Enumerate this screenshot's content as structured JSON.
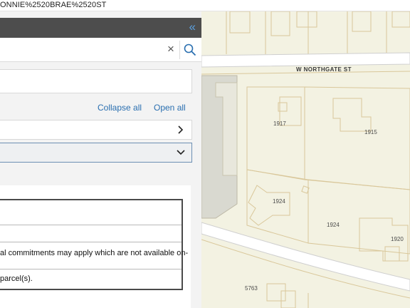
{
  "browser": {
    "url_fragment": "ONNIE%2520BRAE%2520ST"
  },
  "panel": {
    "collapse_icon": "double-chevron-left-icon",
    "search": {
      "value": "",
      "placeholder": "",
      "clear_icon": "close-icon",
      "search_icon": "search-icon"
    },
    "links": {
      "collapse_all": "Collapse all",
      "open_all": "Open all"
    },
    "table_rows": [
      "",
      "",
      "al commitments may apply which are not available on-",
      "parcel(s)."
    ]
  },
  "map": {
    "street": "W NORTHGATE ST",
    "addresses": [
      "1917",
      "1915",
      "1924",
      "1924",
      "1920",
      "5763"
    ]
  },
  "colors": {
    "header": "#4d4d4d",
    "accent": "#2a6fb0",
    "map_bg": "#f3f2e2",
    "parcel_line": "#d9c79a"
  }
}
